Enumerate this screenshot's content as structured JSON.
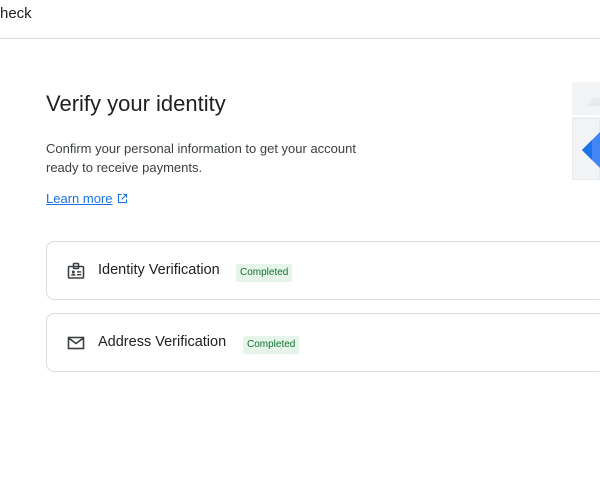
{
  "header": {
    "title": "heck"
  },
  "main": {
    "heading": "Verify your identity",
    "description": "Confirm your personal information to get your account ready to receive payments.",
    "learn_more": "Learn more"
  },
  "cards": [
    {
      "label": "Identity Verification",
      "status": "Completed",
      "icon": "badge-id-icon"
    },
    {
      "label": "Address Verification",
      "status": "Completed",
      "icon": "mail-icon"
    }
  ],
  "colors": {
    "link": "#1a73e8",
    "badge_bg": "#e6f4ea",
    "badge_text": "#137333",
    "border": "#dadce0",
    "illustration_blue": "#4285f4"
  }
}
